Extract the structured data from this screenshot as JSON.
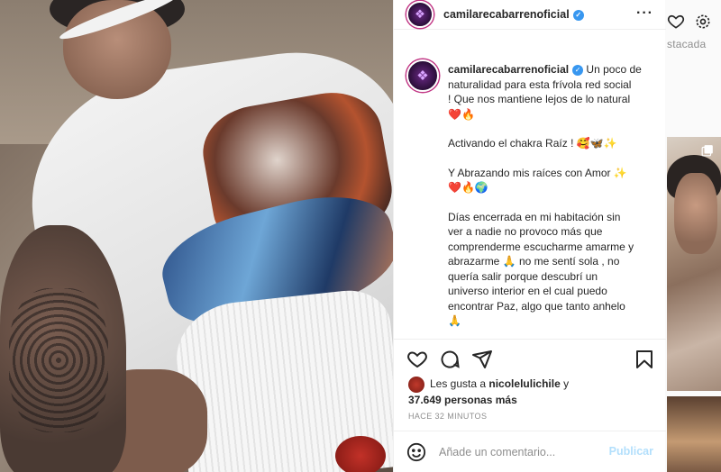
{
  "background": {
    "tab_label": "stacada"
  },
  "post": {
    "username": "camilarecabarrenoficial",
    "verified": true,
    "caption_lines": [
      "Un poco de",
      "naturalidad para esta frívola red social",
      "! Que nos mantiene lejos de lo natural",
      "❤️🔥",
      "",
      "Activando el chakra Raíz ! 🥰🦋✨",
      "",
      "Y Abrazando mis raíces con Amor ✨",
      "❤️🔥🌍",
      "",
      "Días encerrada en mi habitación sin",
      "ver a nadie no provoco más que",
      "comprenderme escucharme amarme y",
      "abrazarme 🙏 no me sentí sola , no",
      "quería salir porque descubrí un",
      "universo interior en el cual puedo",
      "encontrar Paz, algo que tanto anhelo",
      "🙏"
    ],
    "likes_prefix": "Les gusta a",
    "likes_user": "nicolelulichile",
    "likes_and": "y",
    "likes_count": "37.649 personas más",
    "time": "HACE 32 MINUTOS",
    "comment_placeholder": "Añade un comentario...",
    "publish_label": "Publicar"
  },
  "icons": {
    "more": "more-horizontal-icon",
    "like": "heart-icon",
    "comment": "comment-icon",
    "share": "paper-plane-icon",
    "save": "bookmark-icon",
    "emoji": "smiley-icon"
  },
  "colors": {
    "verified": "#3897f0",
    "publish_disabled": "#b2dffc",
    "story_ring": "#c13584"
  }
}
